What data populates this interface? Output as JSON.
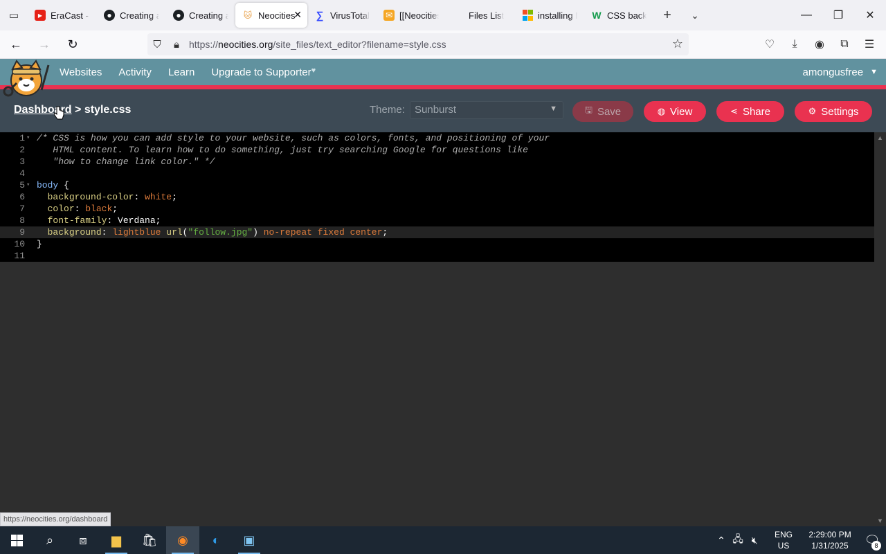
{
  "browser": {
    "tabs": [
      {
        "label": "EraCast - Fu",
        "icon": "youtube-icon"
      },
      {
        "label": "Creating a G",
        "icon": "github-icon"
      },
      {
        "label": "Creating a G",
        "icon": "github-icon"
      },
      {
        "label": "Neocities",
        "icon": "neocities-cat-icon",
        "active": true
      },
      {
        "label": "VirusTotal - I",
        "icon": "virustotal-icon"
      },
      {
        "label": "[[Neocities]",
        "icon": "mail-icon"
      },
      {
        "label": "Files List",
        "icon": ""
      },
      {
        "label": "installing Mi",
        "icon": "microsoft-icon"
      },
      {
        "label": "CSS backgro",
        "icon": "w3schools-icon"
      }
    ],
    "url": {
      "prefix": "https://",
      "host": "neocities.org",
      "path": "/site_files/text_editor?filename=style.css"
    },
    "status_url": "https://neocities.org/dashboard"
  },
  "site": {
    "nav": [
      "Websites",
      "Activity",
      "Learn",
      "Upgrade to Supporter"
    ],
    "username": "amongusfree",
    "colors": {
      "header": "#61929f",
      "accent": "#e93250"
    }
  },
  "editor_toolbar": {
    "breadcrumb_link": "Dashboard",
    "breadcrumb_sep": ">",
    "filename": "style.css",
    "theme_label": "Theme:",
    "theme_value": "Sunburst",
    "buttons": {
      "save": "Save",
      "view": "View",
      "share": "Share",
      "settings": "Settings"
    }
  },
  "code": {
    "language": "css",
    "lines": [
      "/* CSS is how you can add style to your website, such as colors, fonts, and positioning of your",
      "   HTML content. To learn how to do something, just try searching Google for questions like",
      "   \"how to change link color.\" */",
      "",
      "body {",
      "  background-color: white;",
      "  color: black;",
      "  font-family: Verdana;",
      "  background: lightblue url(\"follow.jpg\") no-repeat fixed center;",
      "}",
      ""
    ],
    "active_line": 9
  },
  "taskbar": {
    "lang_top": "ENG",
    "lang_bottom": "US",
    "time": "2:29:00 PM",
    "date": "1/31/2025",
    "notification_count": "8"
  }
}
